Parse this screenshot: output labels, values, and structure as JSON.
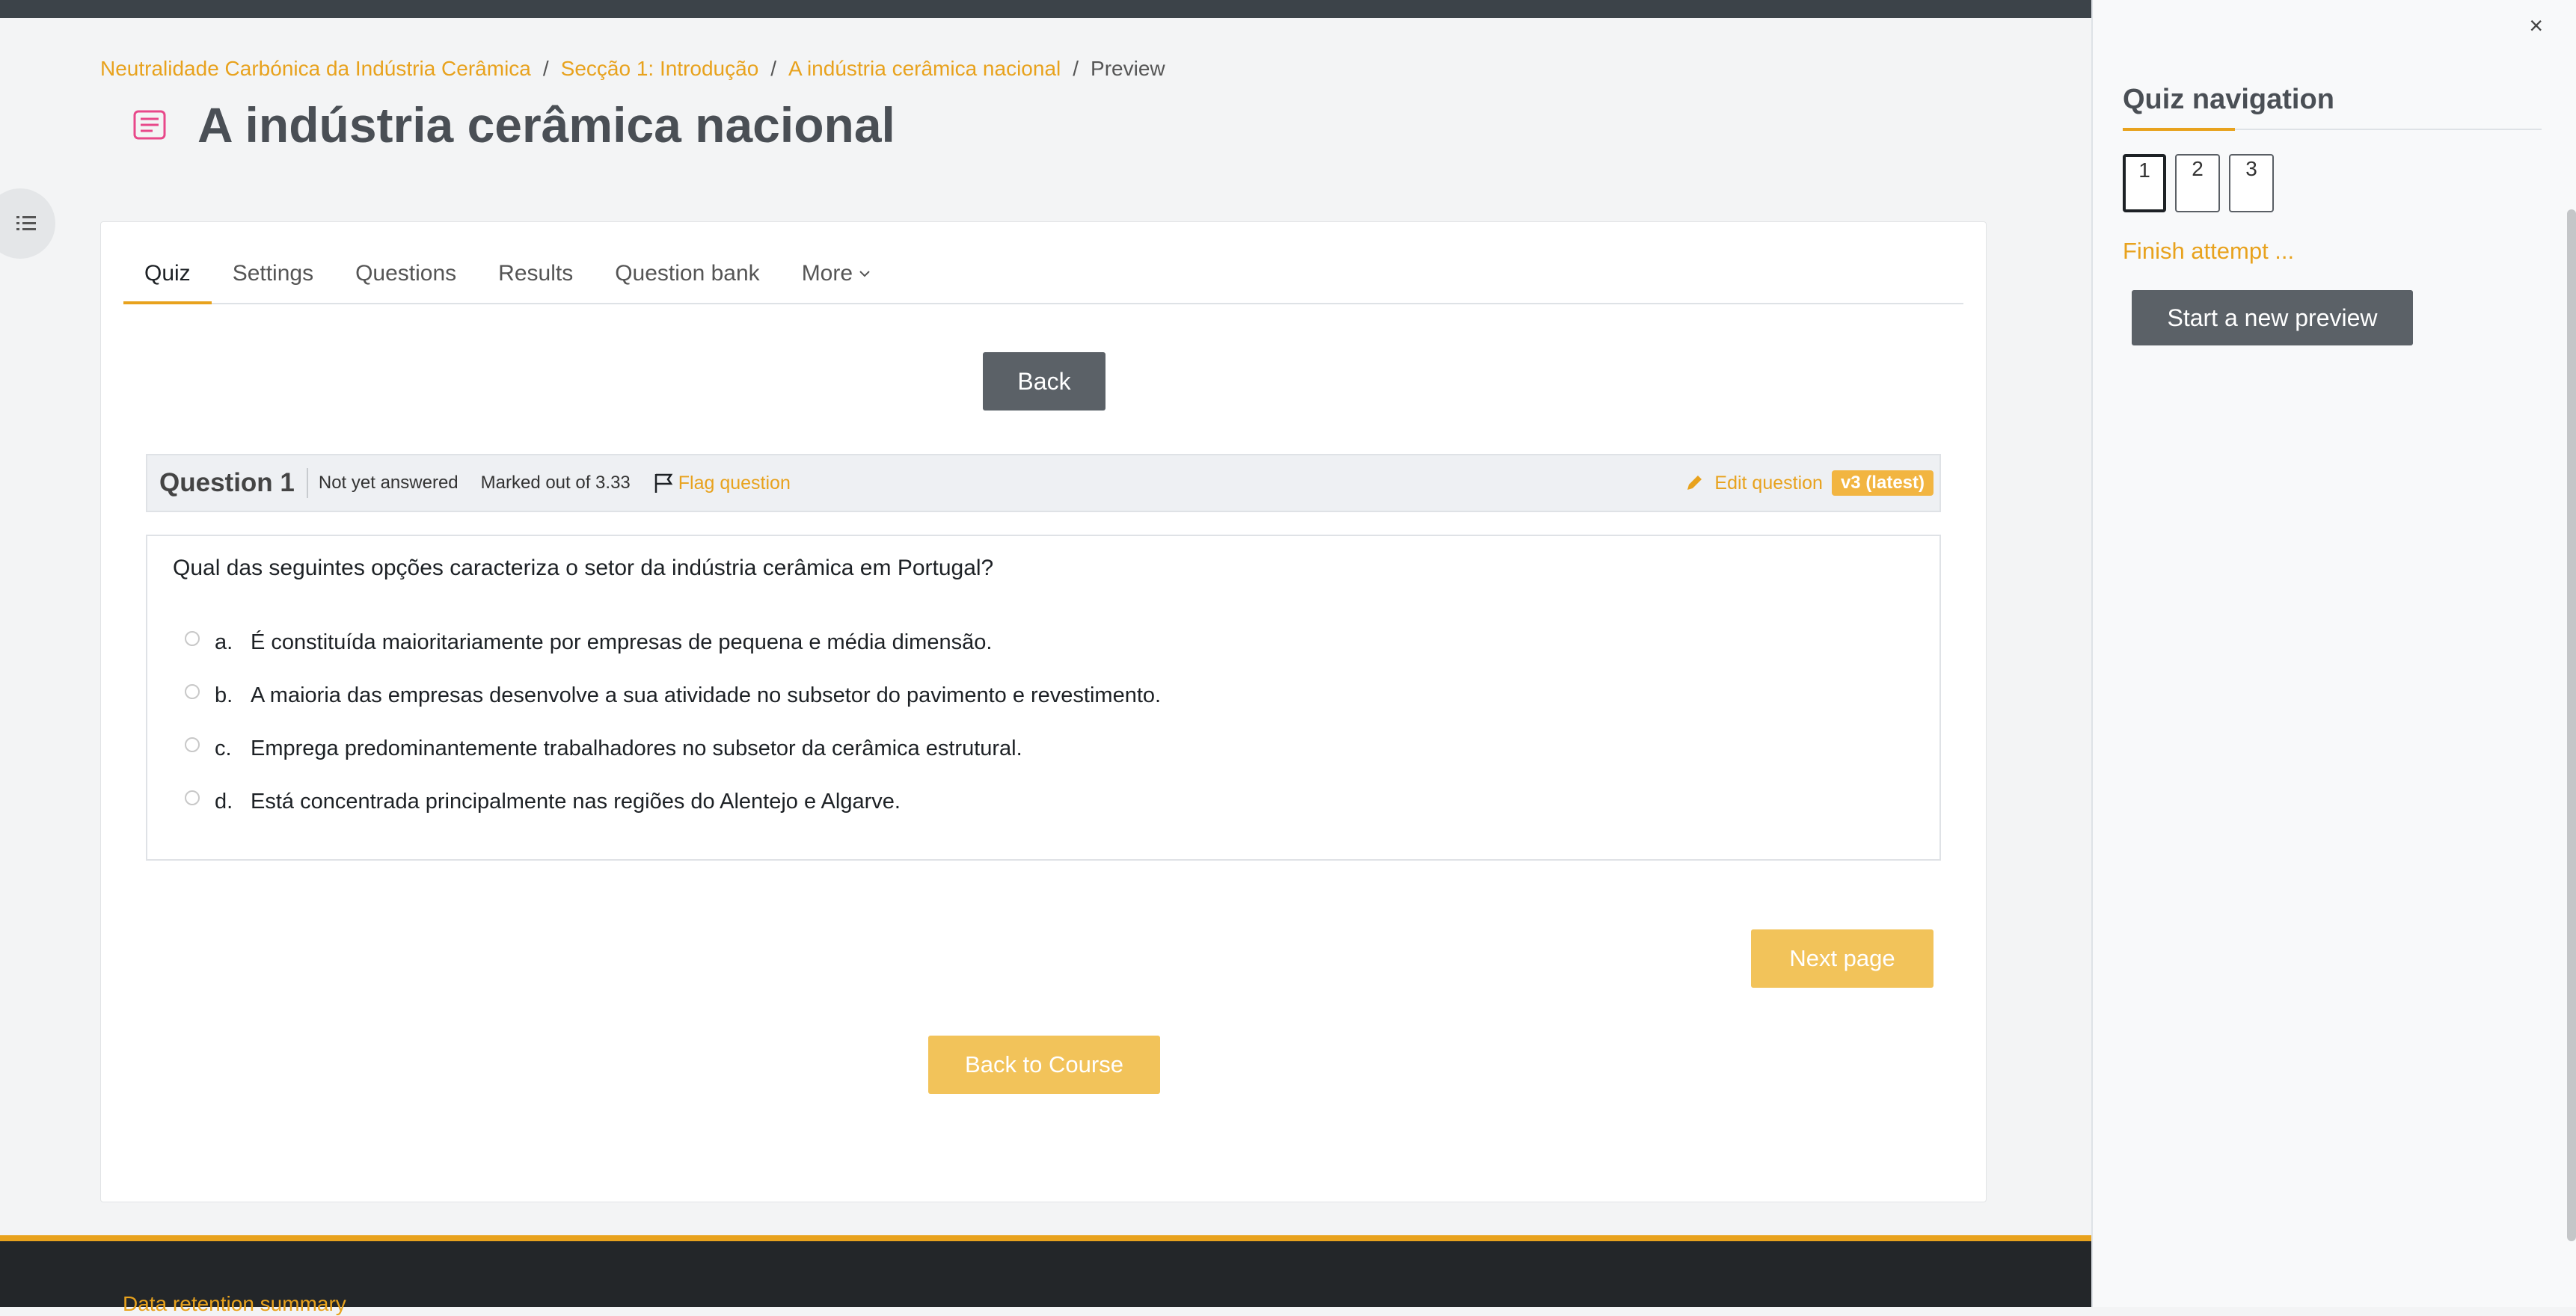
{
  "breadcrumb": {
    "items": [
      "Neutralidade Carbónica da Indústria Cerâmica",
      "Secção 1: Introdução",
      "A indústria cerâmica nacional",
      "Preview"
    ],
    "separator": "/"
  },
  "page": {
    "title": "A indústria cerâmica nacional",
    "icon": "quiz-icon"
  },
  "tabs": [
    "Quiz",
    "Settings",
    "Questions",
    "Results",
    "Question bank",
    "More"
  ],
  "buttons": {
    "back": "Back",
    "next_page": "Next page",
    "back_to_course": "Back to Course",
    "start_preview": "Start a new preview"
  },
  "question": {
    "number_label": "Question 1",
    "state": "Not yet answered",
    "marked_out_of": "Marked out of 3.33",
    "flag": "Flag question",
    "edit": "Edit question",
    "version": "v3 (latest)",
    "text": "Qual das seguintes opções caracteriza o setor da indústria cerâmica em Portugal?",
    "options": [
      {
        "letter": "a.",
        "text": "É constituída maioritariamente por empresas de pequena e média dimensão."
      },
      {
        "letter": "b.",
        "text": "A maioria das empresas desenvolve a sua atividade no subsetor do pavimento e revestimento."
      },
      {
        "letter": "c.",
        "text": "Emprega predominantemente trabalhadores no subsetor da cerâmica estrutural."
      },
      {
        "letter": "d.",
        "text": "Está concentrada principalmente nas regiões do Alentejo e Algarve."
      }
    ]
  },
  "footer": {
    "link": "Data retention summary"
  },
  "drawer": {
    "close": "×",
    "title": "Quiz navigation",
    "questions": [
      "1",
      "2",
      "3"
    ],
    "finish": "Finish attempt ..."
  },
  "colors": {
    "accent": "#e8a21d",
    "button_dark": "#5b6167",
    "button_light": "#f2c35a"
  }
}
